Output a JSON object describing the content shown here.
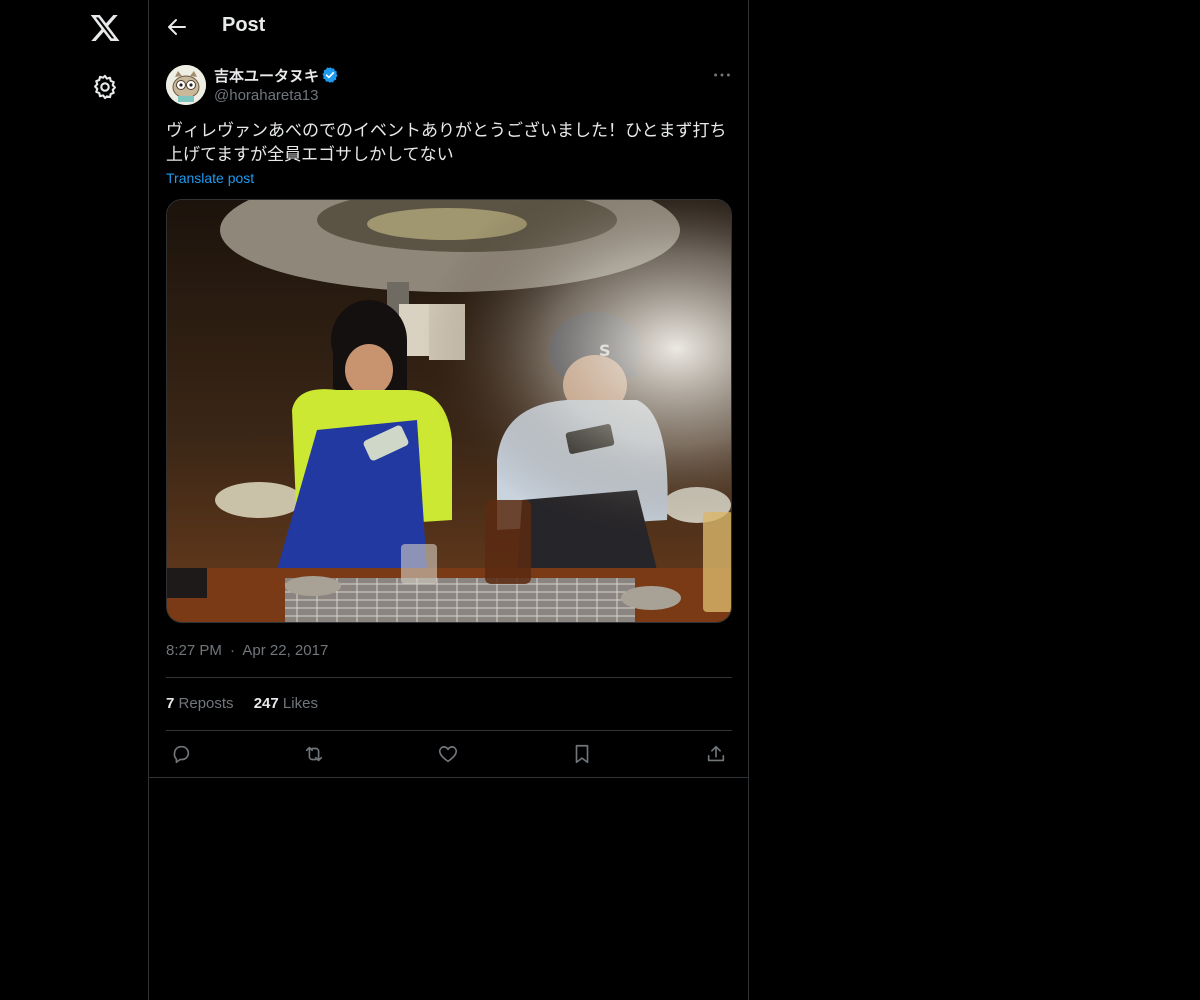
{
  "header": {
    "title": "Post"
  },
  "post": {
    "author_name": "吉本ユータヌキ",
    "handle": "@horahareta13",
    "text": "ヴィレヴァンあべのでのイベントありがとうございました！ひとまず打ち上げてますが全員エゴサしかしてない",
    "translate_label": "Translate post",
    "time": "8:27 PM",
    "separator": "·",
    "date": "Apr 22, 2017"
  },
  "stats": {
    "reposts_count": "7",
    "reposts_label": "Reposts",
    "likes_count": "247",
    "likes_label": "Likes"
  },
  "icons": {
    "logo": "x-logo-icon",
    "settings": "gear-icon",
    "back": "arrow-left-icon",
    "verified": "verified-badge-icon",
    "more": "more-dots-icon",
    "reply": "reply-icon",
    "repost": "repost-icon",
    "like": "heart-icon",
    "bookmark": "bookmark-icon",
    "share": "share-icon"
  },
  "colors": {
    "background": "#000000",
    "text": "#e7e9ea",
    "secondary": "#71767b",
    "accent": "#1d9bf0",
    "border": "#2f3336"
  }
}
